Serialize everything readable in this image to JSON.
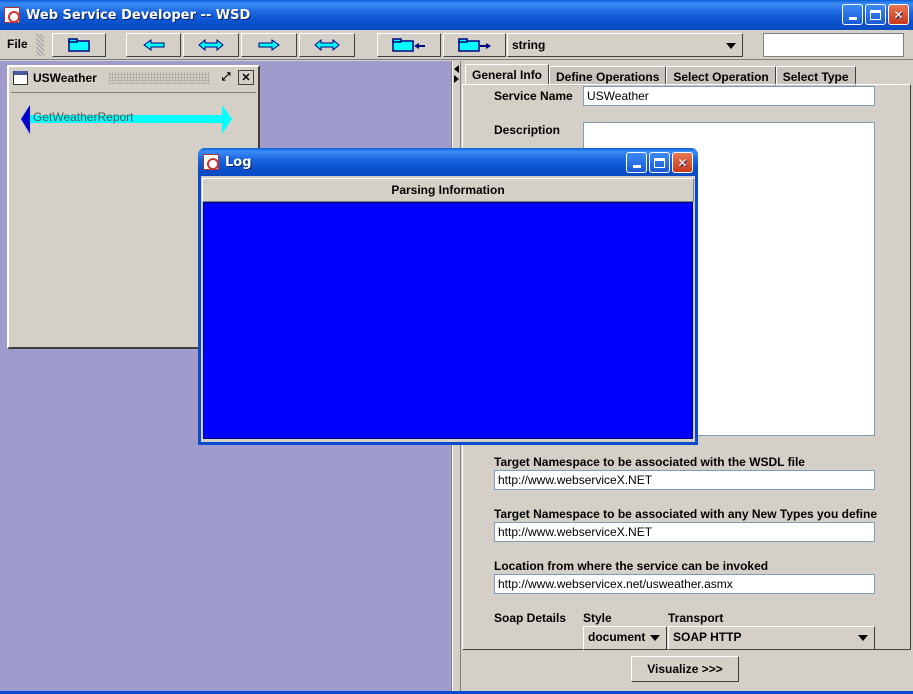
{
  "window": {
    "title": "Web Service Developer -- WSD"
  },
  "menu": {
    "file": "File"
  },
  "toolbar": {
    "type_combo": "string",
    "search_value": ""
  },
  "service_frame": {
    "title": "USWeather",
    "operation": "GetWeatherReport"
  },
  "tabs": [
    {
      "label": "General Info",
      "active": true
    },
    {
      "label": "Define Operations",
      "active": false
    },
    {
      "label": "Select Operation",
      "active": false
    },
    {
      "label": "Select Type",
      "active": false
    }
  ],
  "general": {
    "service_name_label": "Service Name",
    "service_name_value": "USWeather",
    "description_label": "Description",
    "description_value": "",
    "wsdl_ns_label": "Target Namespace to be associated with the WSDL file",
    "wsdl_ns_value": "http://www.webserviceX.NET",
    "types_ns_label": "Target Namespace to be associated with any New Types you define",
    "types_ns_value": "http://www.webserviceX.NET",
    "location_label": "Location from where the service can be invoked",
    "location_value": "http://www.webservicex.net/usweather.asmx",
    "soap_label": "Soap Details",
    "style_label": "Style",
    "style_value": "document",
    "transport_label": "Transport",
    "transport_value": "SOAP HTTP"
  },
  "visualize_button": "Visualize >>>",
  "log": {
    "title": "Log",
    "header": "Parsing Information"
  },
  "colors": {
    "log_background": "#0000ff",
    "desktop": "#9f9ccd",
    "arrow": "#00ffff"
  }
}
